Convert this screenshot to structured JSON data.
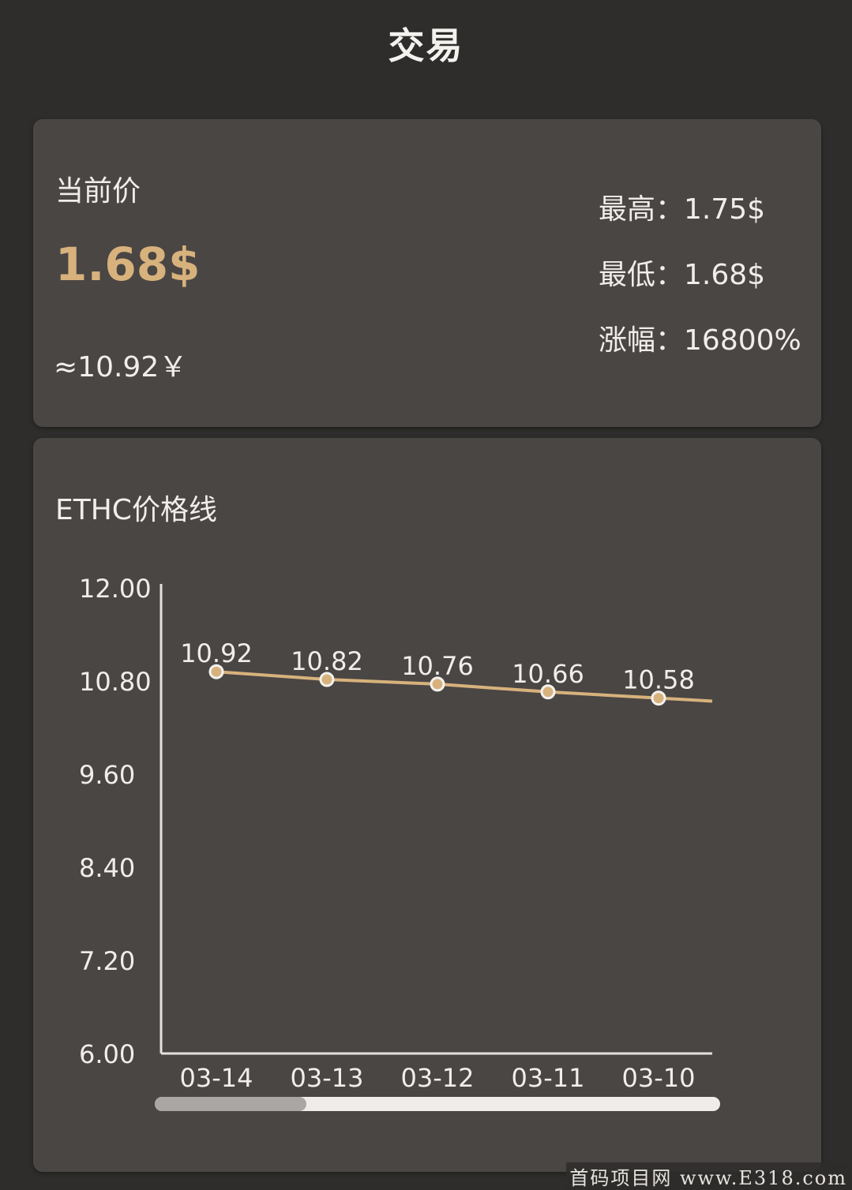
{
  "header": {
    "title": "交易"
  },
  "price_card": {
    "current_label": "当前价",
    "current_price": "1.68$",
    "cny_value": "≈10.92￥",
    "stats": [
      {
        "label": "最高：",
        "value": "1.75$"
      },
      {
        "label": "最低：",
        "value": "1.68$"
      },
      {
        "label": "涨幅：",
        "value": "16800%"
      }
    ]
  },
  "chart_card": {
    "title": "ETHC价格线"
  },
  "colors": {
    "accent": "#d7b27c",
    "card": "#4a4644",
    "background": "#2e2d2c"
  },
  "scrollbar": {
    "position": 0.27
  },
  "watermark": "首码项目网 www.E318.com",
  "chart_data": {
    "type": "line",
    "categories": [
      "03-14",
      "03-13",
      "03-12",
      "03-11",
      "03-10"
    ],
    "series": [
      {
        "values": [
          10.92,
          10.82,
          10.76,
          10.66,
          10.58
        ]
      }
    ],
    "data_labels": [
      "10.92",
      "10.82",
      "10.76",
      "10.66",
      "10.58"
    ],
    "y_ticks": [
      "12.00",
      "10.80",
      "9.60",
      "8.40",
      "7.20",
      "6.00"
    ],
    "ylim": [
      6,
      12
    ],
    "grid": false,
    "legend": "none",
    "title": "ETHC价格线"
  }
}
